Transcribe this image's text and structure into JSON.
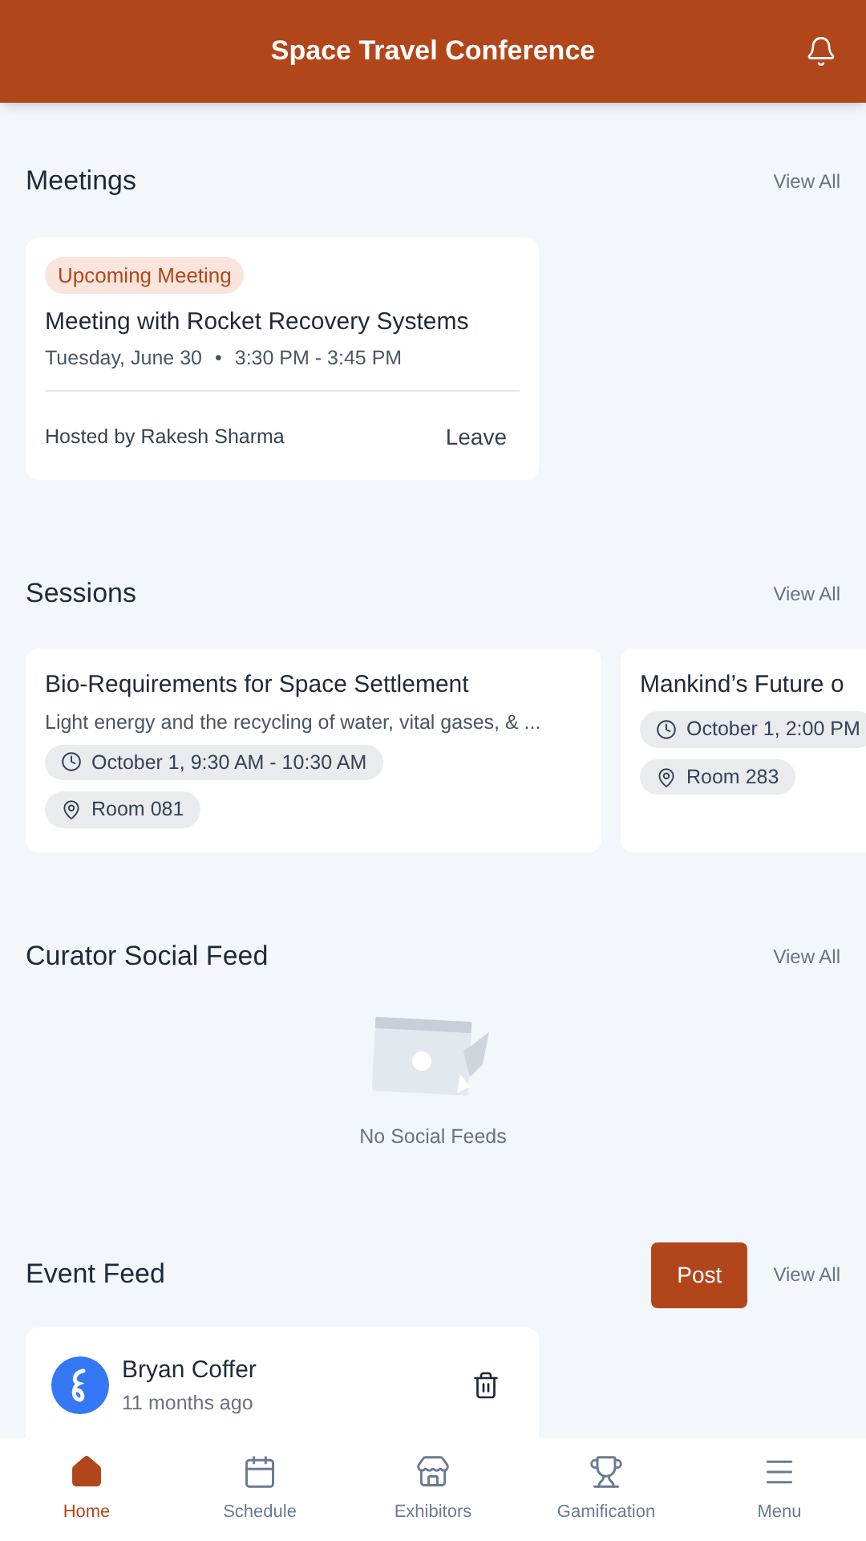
{
  "header": {
    "title": "Space Travel Conference"
  },
  "meetings": {
    "title": "Meetings",
    "view_all": "View All",
    "items": [
      {
        "badge": "Upcoming Meeting",
        "title": "Meeting with Rocket Recovery Systems",
        "date": "Tuesday, June 30",
        "separator": "•",
        "time": "3:30 PM - 3:45 PM",
        "host": "Hosted by Rakesh Sharma",
        "action": "Leave"
      }
    ]
  },
  "sessions": {
    "title": "Sessions",
    "view_all": "View All",
    "items": [
      {
        "title": "Bio-Requirements for Space Settlement",
        "description": "Light energy and the recycling of water, vital gases, & ...",
        "time": "October 1, 9:30 AM - 10:30 AM",
        "room": "Room 081"
      },
      {
        "title": "Mankind’s Future o",
        "time": "October 1, 2:00 PM",
        "room": "Room 283"
      }
    ]
  },
  "social_feed": {
    "title": "Curator Social Feed",
    "view_all": "View All",
    "empty_text": "No Social Feeds"
  },
  "event_feed": {
    "title": "Event Feed",
    "post_button": "Post",
    "view_all": "View All",
    "posts": [
      {
        "author": "Bryan Coffer",
        "time": "11 months ago"
      }
    ]
  },
  "bottom_nav": [
    {
      "kind": "home",
      "label": "Home",
      "selected": true
    },
    {
      "kind": "calendar",
      "label": "Schedule",
      "selected": false
    },
    {
      "kind": "booth",
      "label": "Exhibitors",
      "selected": false
    },
    {
      "kind": "trophy",
      "label": "Gamification",
      "selected": false
    },
    {
      "kind": "menu",
      "label": "Menu",
      "selected": false
    }
  ]
}
